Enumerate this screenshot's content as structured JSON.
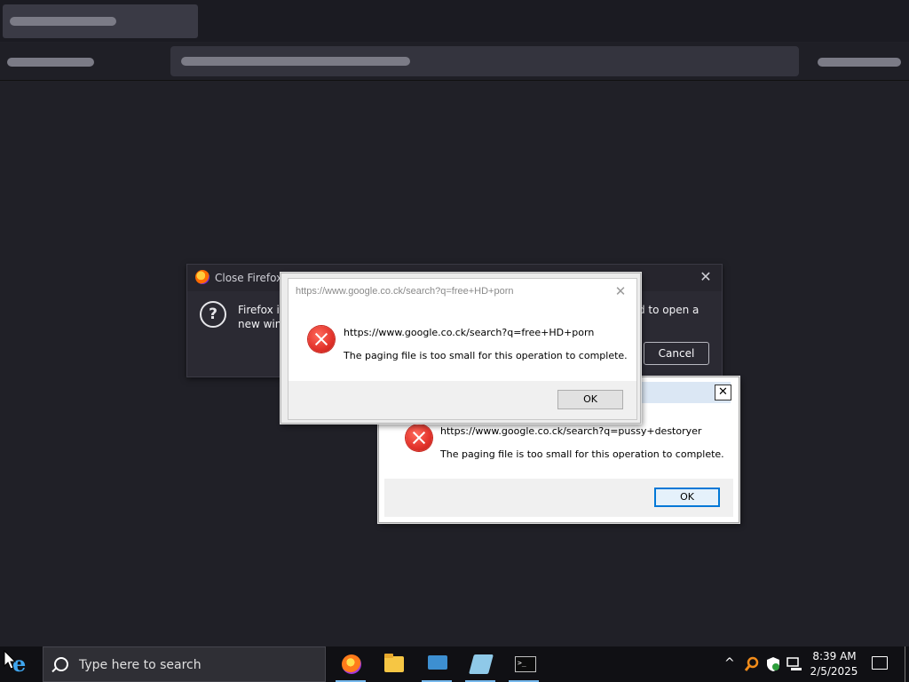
{
  "ff_dialog": {
    "title": "Close Firefox",
    "text_line1": "Firefox is",
    "text_line2": "new winc",
    "text_right": "d to open a",
    "cancel_label": "Cancel"
  },
  "error_dialog_front": {
    "title": "https://www.google.co.ck/search?q=free+HD+porn",
    "heading": "https://www.google.co.ck/search?q=free+HD+porn",
    "message": "The paging file is too small for this operation to complete.",
    "ok_label": "OK"
  },
  "error_dialog_back": {
    "title_fragment": "r",
    "heading": "https://www.google.co.ck/search?q=pussy+destoryer",
    "message": "The paging file is too small for this operation to complete.",
    "ok_label": "OK"
  },
  "taskbar": {
    "search_placeholder": "Type here to search",
    "apps": [
      "firefox-icon",
      "file-explorer-icon",
      "network-icon",
      "notepad-icon",
      "command-prompt-icon"
    ],
    "time": "8:39 AM",
    "date": "2/5/2025"
  },
  "colors": {
    "background": "#202027",
    "taskbar": "#101014",
    "error_red": "#e2322a",
    "taskbar_accent": "#76b9ed"
  }
}
